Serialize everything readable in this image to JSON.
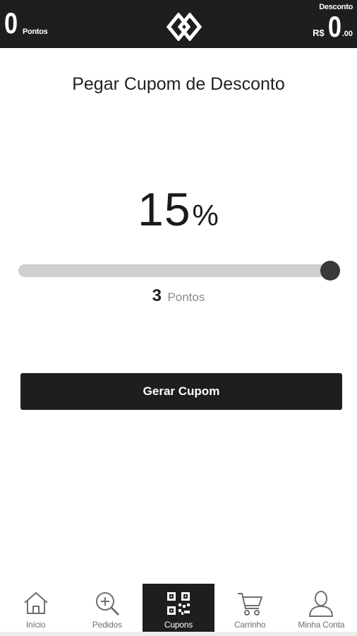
{
  "header": {
    "points_value": "0",
    "points_label": "Pontos",
    "discount_label": "Desconto",
    "currency": "R$",
    "discount_integer": "0",
    "discount_decimal": ".00"
  },
  "main": {
    "title": "Pegar Cupom de Desconto",
    "discount_percent_value": "15",
    "discount_percent_symbol": "%",
    "slider_level_fraction": 1.0,
    "points_cost_value": "3",
    "points_cost_label": "Pontos",
    "generate_button_label": "Gerar Cupom"
  },
  "nav": {
    "items": [
      {
        "label": "Início",
        "icon": "home-icon",
        "active": false
      },
      {
        "label": "Pedidos",
        "icon": "search-plus-icon",
        "active": false
      },
      {
        "label": "Cupons",
        "icon": "qr-code-icon",
        "active": true
      },
      {
        "label": "Carrinho",
        "icon": "cart-icon",
        "active": false
      },
      {
        "label": "Minha Conta",
        "icon": "user-icon",
        "active": false
      }
    ]
  },
  "colors": {
    "dark": "#1e1e1e",
    "track": "#cfcfcf",
    "thumb": "#3a3a3a",
    "muted_text": "#8a8a8a"
  }
}
